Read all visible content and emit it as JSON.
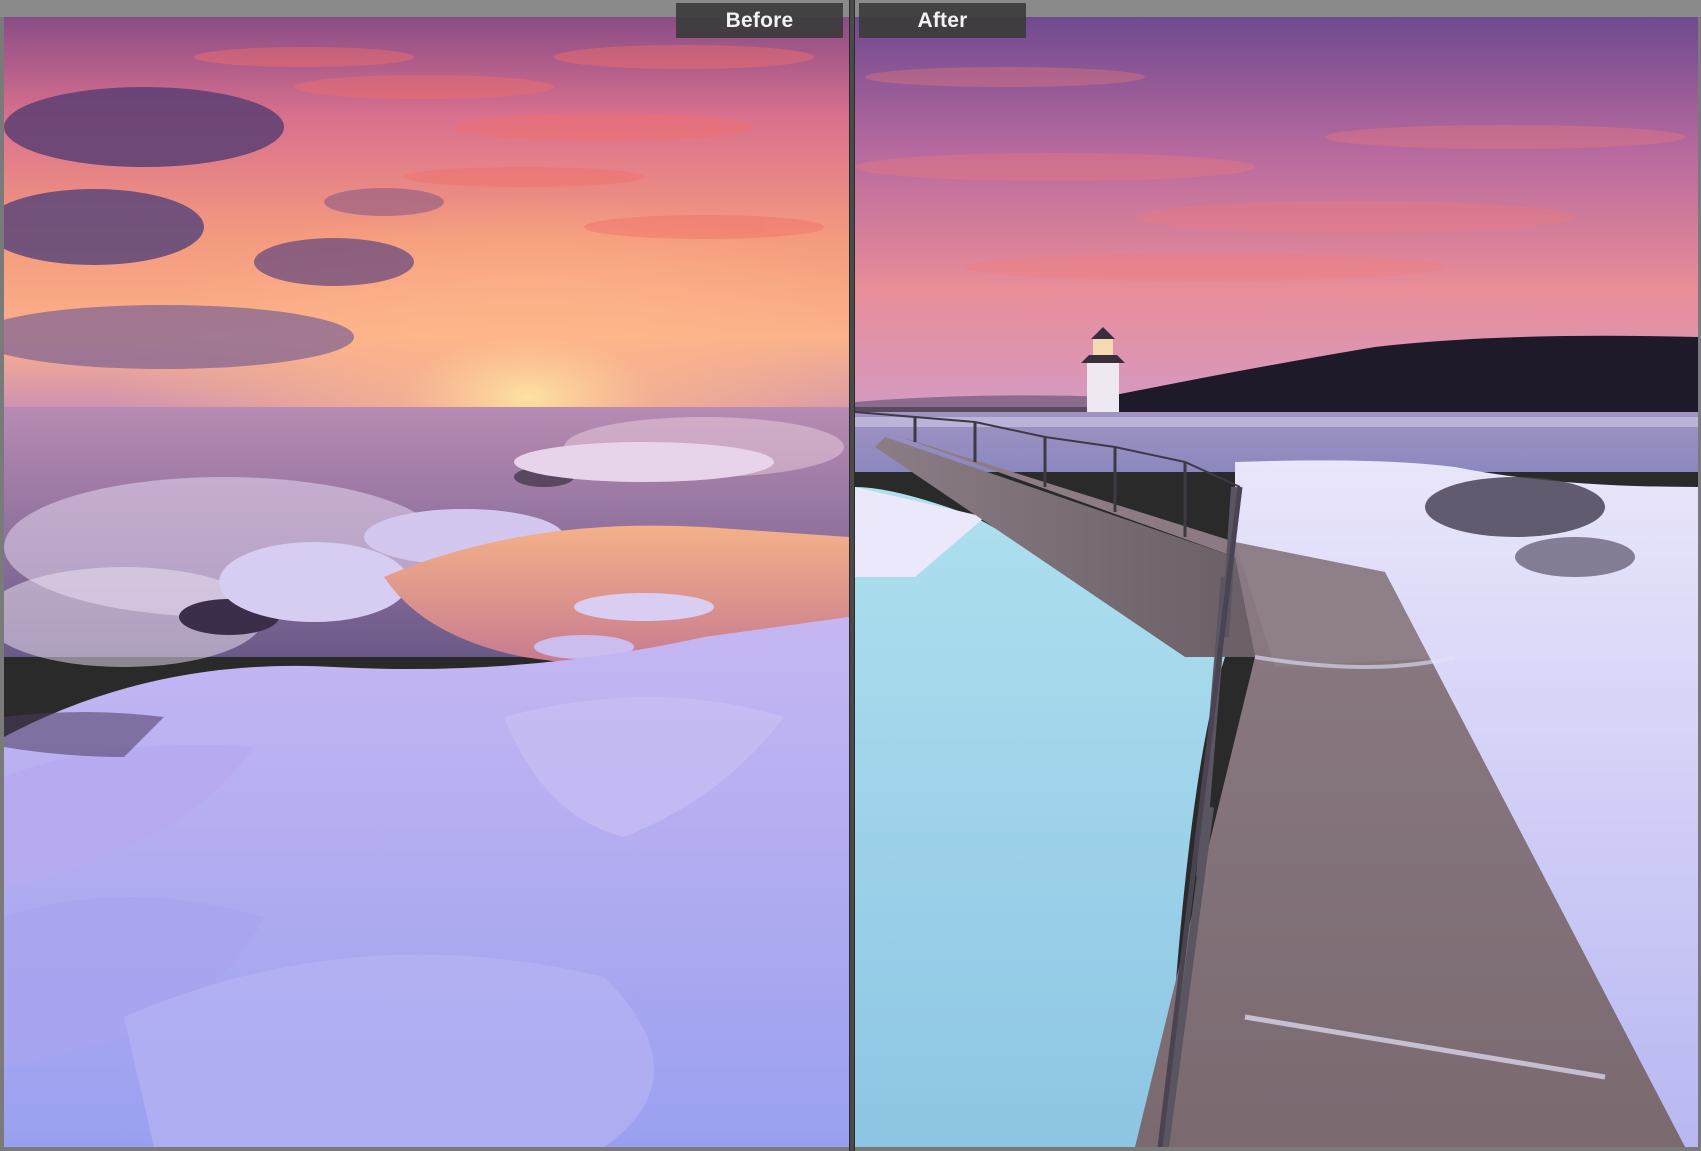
{
  "labels": {
    "before": "Before",
    "after": "After"
  },
  "panes": {
    "before": {
      "scene": "sunrise-over-icy-lakeshore"
    },
    "after": {
      "scene": "lighthouse-pier-in-snow"
    }
  },
  "colors": {
    "frame": "#7a7a7a",
    "divider": "#4a4a4a",
    "label_bg": "#3c3c3c",
    "label_text": "#f2f2f2"
  }
}
